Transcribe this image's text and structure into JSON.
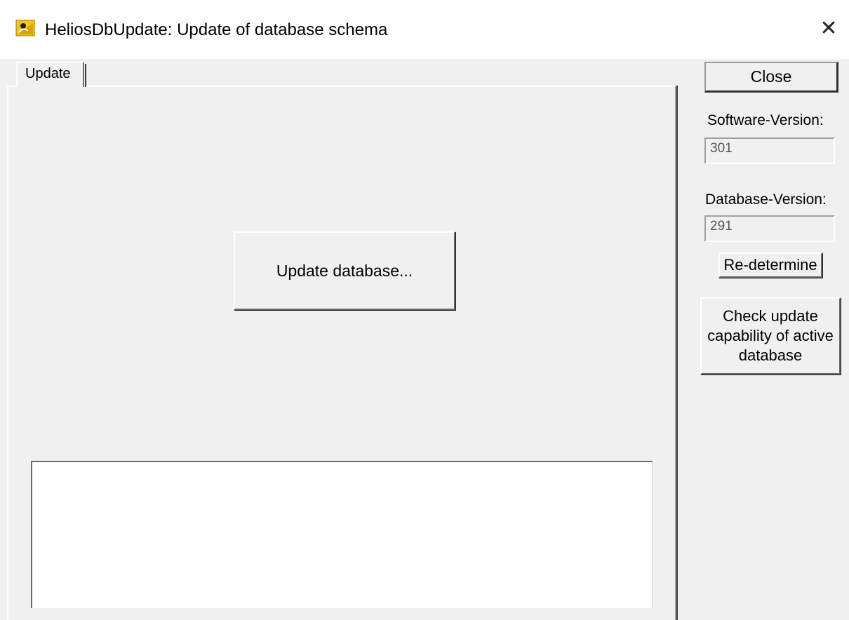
{
  "window": {
    "title": "HeliosDbUpdate: Update of database schema",
    "icon": "helios-app-icon",
    "close_glyph": "✕"
  },
  "tabs": [
    {
      "label": "Update",
      "active": true
    }
  ],
  "main": {
    "update_button_label": "Update database...",
    "log_text": ""
  },
  "side": {
    "close_label": "Close",
    "software_version_label": "Software-Version:",
    "software_version_value": "301",
    "database_version_label": "Database-Version:",
    "database_version_value": "291",
    "redetermine_label": "Re-determine",
    "check_label_line1": "Check update",
    "check_label_line2": "capability of active",
    "check_label_line3": "database"
  },
  "colors": {
    "background": "#f0f0f0",
    "titlebar": "#ffffff",
    "icon_bg": "#f5c518"
  }
}
